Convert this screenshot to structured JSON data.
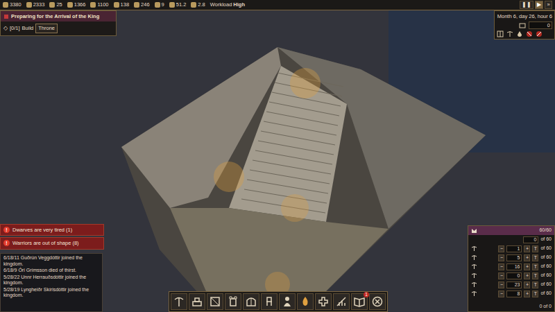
{
  "top_bar": {
    "resources": [
      {
        "value": "3380"
      },
      {
        "value": "2333"
      },
      {
        "value": "25"
      },
      {
        "value": "1366"
      },
      {
        "value": "1100"
      },
      {
        "value": "138"
      },
      {
        "value": "246"
      },
      {
        "value": "9"
      },
      {
        "value": "51.2"
      },
      {
        "value": "2.8"
      }
    ],
    "workload_label": "Workload",
    "workload": "High",
    "speed_buttons": [
      {
        "label": "❚❚",
        "selected": false
      },
      {
        "label": "▶",
        "selected": true
      },
      {
        "label": "»",
        "selected": false
      }
    ]
  },
  "quest": {
    "title": "Preparing for the Arrival of the King",
    "tasks": [
      {
        "icon": "◇",
        "count": "[0/1]",
        "action": "Build",
        "target": "Throne"
      }
    ]
  },
  "clock": {
    "time": "Month 6, day 26, hour 6",
    "value": "0"
  },
  "alerts": [
    {
      "icon": "!",
      "text": "Dwarves are very tired (1)"
    },
    {
      "icon": "!",
      "text": "Warriors are out of shape (8)"
    }
  ],
  "log": [
    "6/18/11 Guðrún Veggdóttir joined the kingdom.",
    "6/18/9 Óri Grímsson died of thirst.",
    "5/28/22 Unnr Herrauðsdóttir joined the kingdom.",
    "5/28/19 Lyngheiðr Skírisdóttir joined the kingdom."
  ],
  "army": {
    "total": "60/60",
    "unassigned": "0",
    "unassigned_of": "of 60",
    "squads": [
      {
        "minus": "−",
        "value": "1",
        "plus": "+",
        "letter": "T",
        "of": "of 60"
      },
      {
        "minus": "−",
        "value": "5",
        "plus": "+",
        "letter": "T",
        "of": "of 60"
      },
      {
        "minus": "−",
        "value": "16",
        "plus": "+",
        "letter": "T",
        "of": "of 60"
      },
      {
        "minus": "−",
        "value": "0",
        "plus": "+",
        "letter": "T",
        "of": "of 60"
      },
      {
        "minus": "−",
        "value": "23",
        "plus": "+",
        "letter": "T",
        "of": "of 60"
      },
      {
        "minus": "−",
        "value": "8",
        "plus": "+",
        "letter": "T",
        "of": "of 60"
      }
    ],
    "footer": "0 of 0"
  },
  "toolbar": [
    {
      "kind": "pick",
      "badge": ""
    },
    {
      "kind": "build",
      "badge": ""
    },
    {
      "kind": "stock",
      "badge": ""
    },
    {
      "kind": "tower",
      "badge": ""
    },
    {
      "kind": "gate",
      "badge": ""
    },
    {
      "kind": "furniture",
      "badge": ""
    },
    {
      "kind": "person",
      "badge": ""
    },
    {
      "kind": "fire",
      "badge": ""
    },
    {
      "kind": "cross",
      "badge": ""
    },
    {
      "kind": "farm",
      "badge": ""
    },
    {
      "kind": "book",
      "badge": "1"
    },
    {
      "kind": "cancel",
      "badge": ""
    }
  ]
}
